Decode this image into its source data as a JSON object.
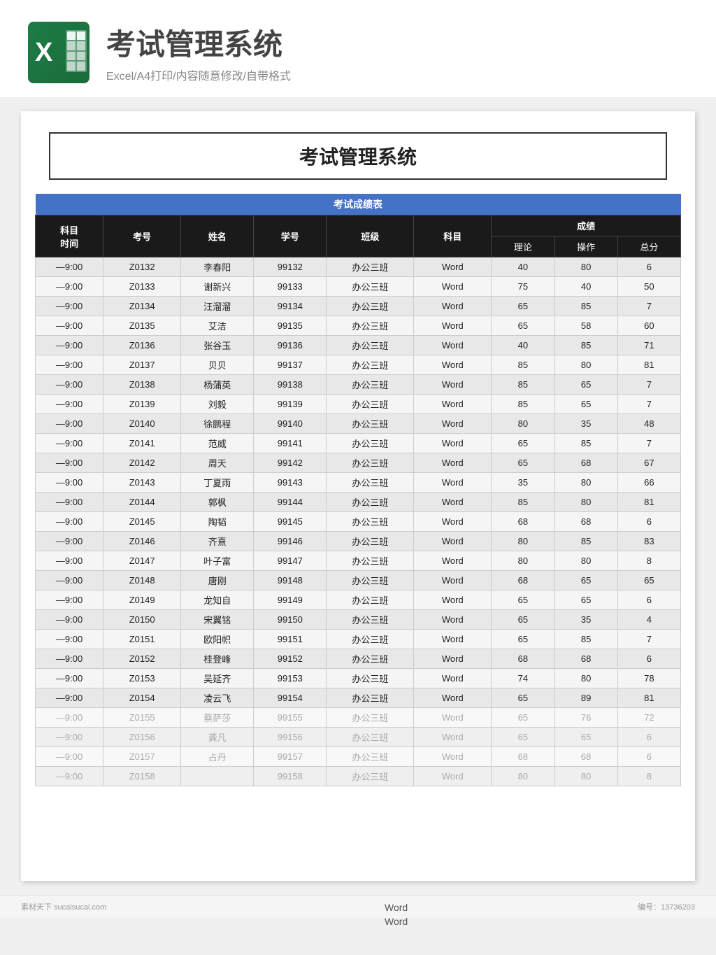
{
  "header": {
    "title": "考试管理系统",
    "subtitle": "Excel/A4打印/内容随意修改/自带格式"
  },
  "document": {
    "title": "考试管理系统",
    "table": {
      "section_title": "考试成绩表",
      "columns": {
        "time": "科目\n时间",
        "exam_no": "考号",
        "name": "姓名",
        "student_no": "学号",
        "class": "班级",
        "subject": "科目",
        "score_group": "成绩",
        "theory": "理论",
        "operation": "操作",
        "total": "总分"
      },
      "rows": [
        {
          "time": "—9:00",
          "exam_no": "Z0132",
          "name": "李春阳",
          "student_no": "99132",
          "class": "办公三班",
          "subject": "Word",
          "theory": 40,
          "operation": 80,
          "total": 6
        },
        {
          "time": "—9:00",
          "exam_no": "Z0133",
          "name": "谢新兴",
          "student_no": "99133",
          "class": "办公三班",
          "subject": "Word",
          "theory": 75,
          "operation": 40,
          "total": 50
        },
        {
          "time": "—9:00",
          "exam_no": "Z0134",
          "name": "汪溜溜",
          "student_no": "99134",
          "class": "办公三班",
          "subject": "Word",
          "theory": 65,
          "operation": 85,
          "total": 7
        },
        {
          "time": "—9:00",
          "exam_no": "Z0135",
          "name": "艾洁",
          "student_no": "99135",
          "class": "办公三班",
          "subject": "Word",
          "theory": 65,
          "operation": 58,
          "total": 60
        },
        {
          "time": "—9:00",
          "exam_no": "Z0136",
          "name": "张谷玉",
          "student_no": "99136",
          "class": "办公三班",
          "subject": "Word",
          "theory": 40,
          "operation": 85,
          "total": 71
        },
        {
          "time": "—9:00",
          "exam_no": "Z0137",
          "name": "贝贝",
          "student_no": "99137",
          "class": "办公三班",
          "subject": "Word",
          "theory": 85,
          "operation": 80,
          "total": 81
        },
        {
          "time": "—9:00",
          "exam_no": "Z0138",
          "name": "杨蒲英",
          "student_no": "99138",
          "class": "办公三班",
          "subject": "Word",
          "theory": 85,
          "operation": 65,
          "total": 7
        },
        {
          "time": "—9:00",
          "exam_no": "Z0139",
          "name": "刘毅",
          "student_no": "99139",
          "class": "办公三班",
          "subject": "Word",
          "theory": 85,
          "operation": 65,
          "total": 7
        },
        {
          "time": "—9:00",
          "exam_no": "Z0140",
          "name": "徐鹏程",
          "student_no": "99140",
          "class": "办公三班",
          "subject": "Word",
          "theory": 80,
          "operation": 35,
          "total": 48
        },
        {
          "time": "—9:00",
          "exam_no": "Z0141",
          "name": "范威",
          "student_no": "99141",
          "class": "办公三班",
          "subject": "Word",
          "theory": 65,
          "operation": 85,
          "total": 7
        },
        {
          "time": "—9:00",
          "exam_no": "Z0142",
          "name": "周天",
          "student_no": "99142",
          "class": "办公三班",
          "subject": "Word",
          "theory": 65,
          "operation": 68,
          "total": 67
        },
        {
          "time": "—9:00",
          "exam_no": "Z0143",
          "name": "丁夏雨",
          "student_no": "99143",
          "class": "办公三班",
          "subject": "Word",
          "theory": 35,
          "operation": 80,
          "total": 66
        },
        {
          "time": "—9:00",
          "exam_no": "Z0144",
          "name": "郭枫",
          "student_no": "99144",
          "class": "办公三班",
          "subject": "Word",
          "theory": 85,
          "operation": 80,
          "total": 81
        },
        {
          "time": "—9:00",
          "exam_no": "Z0145",
          "name": "陶韬",
          "student_no": "99145",
          "class": "办公三班",
          "subject": "Word",
          "theory": 68,
          "operation": 68,
          "total": 6
        },
        {
          "time": "—9:00",
          "exam_no": "Z0146",
          "name": "齐熹",
          "student_no": "99146",
          "class": "办公三班",
          "subject": "Word",
          "theory": 80,
          "operation": 85,
          "total": 83
        },
        {
          "time": "—9:00",
          "exam_no": "Z0147",
          "name": "叶子富",
          "student_no": "99147",
          "class": "办公三班",
          "subject": "Word",
          "theory": 80,
          "operation": 80,
          "total": 8
        },
        {
          "time": "—9:00",
          "exam_no": "Z0148",
          "name": "唐刚",
          "student_no": "99148",
          "class": "办公三班",
          "subject": "Word",
          "theory": 68,
          "operation": 65,
          "total": 65
        },
        {
          "time": "—9:00",
          "exam_no": "Z0149",
          "name": "龙知自",
          "student_no": "99149",
          "class": "办公三班",
          "subject": "Word",
          "theory": 65,
          "operation": 65,
          "total": 6
        },
        {
          "time": "—9:00",
          "exam_no": "Z0150",
          "name": "宋翼铭",
          "student_no": "99150",
          "class": "办公三班",
          "subject": "Word",
          "theory": 65,
          "operation": 35,
          "total": 4
        },
        {
          "time": "—9:00",
          "exam_no": "Z0151",
          "name": "欧阳帜",
          "student_no": "99151",
          "class": "办公三班",
          "subject": "Word",
          "theory": 65,
          "operation": 85,
          "total": 7
        },
        {
          "time": "—9:00",
          "exam_no": "Z0152",
          "name": "桂登峰",
          "student_no": "99152",
          "class": "办公三班",
          "subject": "Word",
          "theory": 68,
          "operation": 68,
          "total": 6
        },
        {
          "time": "—9:00",
          "exam_no": "Z0153",
          "name": "吴延齐",
          "student_no": "99153",
          "class": "办公三班",
          "subject": "Word",
          "theory": 74,
          "operation": 80,
          "total": 78
        },
        {
          "time": "—9:00",
          "exam_no": "Z0154",
          "name": "凌云飞",
          "student_no": "99154",
          "class": "办公三班",
          "subject": "Word",
          "theory": 65,
          "operation": 89,
          "total": 81
        },
        {
          "time": "—9:00",
          "exam_no": "Z0155",
          "name": "蔡萨莎",
          "student_no": "99155",
          "class": "办公三班",
          "subject": "Word",
          "theory": 65,
          "operation": 76,
          "total": 72,
          "faded": true
        },
        {
          "time": "—9:00",
          "exam_no": "Z0156",
          "name": "龚凡",
          "student_no": "99156",
          "class": "办公三班",
          "subject": "Word",
          "theory": 65,
          "operation": 65,
          "total": 6,
          "faded": true
        },
        {
          "time": "—9:00",
          "exam_no": "Z0157",
          "name": "占丹",
          "student_no": "99157",
          "class": "办公三班",
          "subject": "Word",
          "theory": 68,
          "operation": 68,
          "total": 6,
          "faded": true
        },
        {
          "time": "—9:00",
          "exam_no": "Z0158",
          "name": "",
          "student_no": "99158",
          "class": "办公三班",
          "subject": "Word",
          "theory": 80,
          "operation": 80,
          "total": 8,
          "faded": true
        }
      ]
    }
  },
  "footer": {
    "brand": "素材天下 sucaisucai.com",
    "serial": "编号：13736203",
    "word_label1": "Word",
    "word_label2": "Word"
  }
}
